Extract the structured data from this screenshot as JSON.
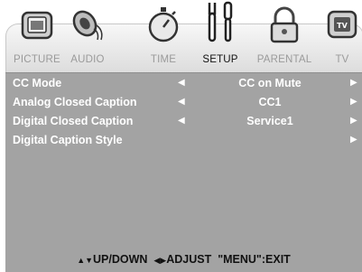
{
  "tabs": [
    {
      "label": "PICTURE",
      "icon": "picture-icon",
      "active": false
    },
    {
      "label": "AUDIO",
      "icon": "speaker-icon",
      "active": false
    },
    {
      "label": "TIME",
      "icon": "stopwatch-icon",
      "active": false
    },
    {
      "label": "SETUP",
      "icon": "tools-icon",
      "active": true
    },
    {
      "label": "PARENTAL",
      "icon": "lock-icon",
      "active": false
    },
    {
      "label": "TV",
      "icon": "tv-icon",
      "active": false
    }
  ],
  "menu": [
    {
      "name": "CC Mode",
      "value": "CC on Mute",
      "left_arrow": "◀",
      "right_arrow": "▶"
    },
    {
      "name": "Analog Closed Caption",
      "value": "CC1",
      "left_arrow": "◀",
      "right_arrow": "▶"
    },
    {
      "name": "Digital Closed Caption",
      "value": "Service1",
      "left_arrow": "◀",
      "right_arrow": "▶"
    },
    {
      "name": "Digital Caption Style",
      "value": "",
      "left_arrow": "",
      "right_arrow": "▶"
    }
  ],
  "footer": {
    "updown_keys": "▲▼",
    "updown_label": "UP/DOWN",
    "adjust_keys": "◀▶",
    "adjust_label": "ADJUST",
    "exit_label": "\"MENU\":EXIT"
  },
  "colors": {
    "panel": "#a3a3a3",
    "tab_bar": "#e6e6e6",
    "inactive_label": "#9a9a9a"
  }
}
